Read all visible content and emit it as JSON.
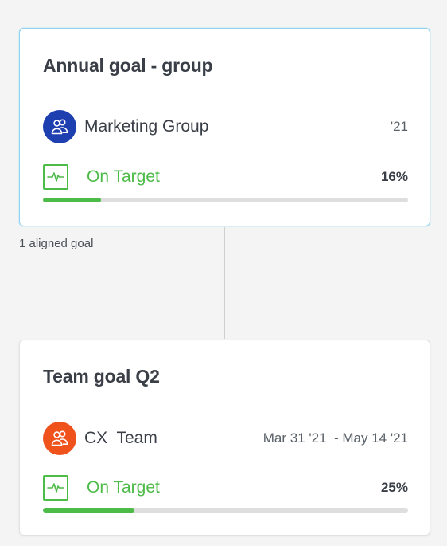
{
  "parent_goal": {
    "title": "Annual goal - group",
    "owner": {
      "name": "Marketing Group",
      "avatar_icon": "group-icon",
      "avatar_color": "#1e3fb0"
    },
    "period": "'21",
    "status": {
      "label": "On Target",
      "icon": "activity-pulse-icon",
      "color": "#4dbb47"
    },
    "progress": {
      "label": "16%",
      "value": 0.16
    }
  },
  "aligned": {
    "label": "1 aligned goal"
  },
  "child_goal": {
    "title": "Team goal Q2",
    "owner": {
      "name": "CX  Team",
      "avatar_icon": "group-icon",
      "avatar_color": "#f0521c"
    },
    "period": "Mar 31 '21  - May 14 '21",
    "status": {
      "label": "On Target",
      "icon": "activity-pulse-icon",
      "color": "#4dbb47"
    },
    "progress": {
      "label": "25%",
      "value": 0.25
    }
  },
  "colors": {
    "accent_border": "#8fd3f0",
    "progress_track": "#dedede",
    "on_target": "#4dbb47"
  }
}
